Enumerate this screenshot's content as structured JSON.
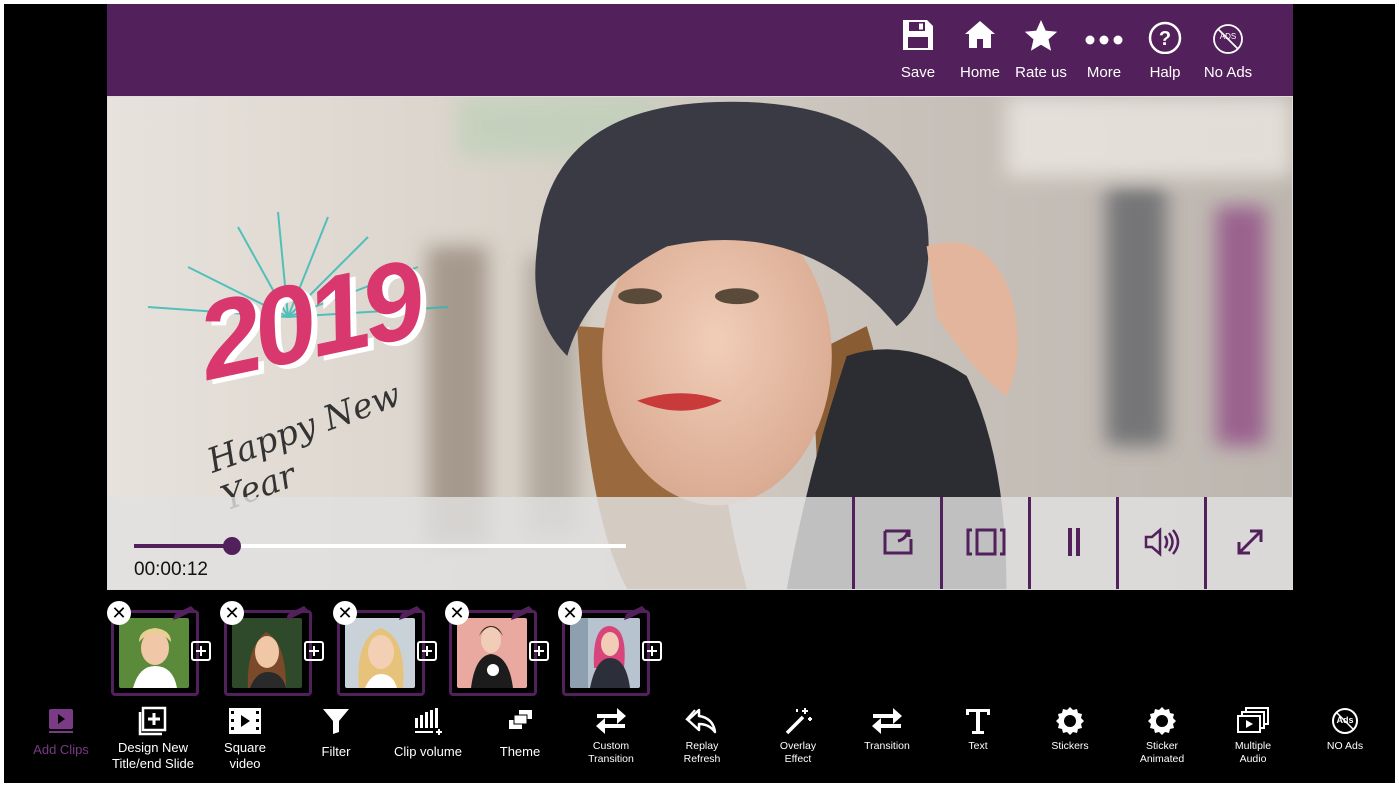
{
  "topbar": {
    "items": [
      {
        "label": "Save",
        "icon": "floppy-disk-icon"
      },
      {
        "label": "Home",
        "icon": "home-icon"
      },
      {
        "label": "Rate us",
        "icon": "star-icon"
      },
      {
        "label": "More",
        "icon": "dots-icon"
      },
      {
        "label": "Halp",
        "icon": "question-circle-icon"
      },
      {
        "label": "No Ads",
        "icon": "no-ads-icon"
      }
    ],
    "no_ads_badge": "ADS"
  },
  "preview": {
    "overlay_year": "2019",
    "overlay_text": "Happy New Year",
    "time": "00:00:12",
    "progress": 0.2
  },
  "clips": {
    "count": 5,
    "delete_glyph": "✕"
  },
  "toolbar": {
    "items": [
      {
        "label": "Add Clips",
        "icon": "video-clip-icon"
      },
      {
        "label": "Design New",
        "label2": "Title/end Slide",
        "icon": "add-slide-icon"
      },
      {
        "label": "Square",
        "label2": "video",
        "icon": "film-strip-icon"
      },
      {
        "label": "Filter",
        "icon": "funnel-icon"
      },
      {
        "label": "Clip volume",
        "icon": "volume-bars-icon"
      },
      {
        "label": "Theme",
        "icon": "theme-icon"
      },
      {
        "label": "Custom",
        "label2": "Transition",
        "icon": "swap-arrows-icon"
      },
      {
        "label": "Replay",
        "label2": "Refresh",
        "icon": "replay-icon"
      },
      {
        "label": "Overlay",
        "label2": "Effect",
        "icon": "magic-wand-icon"
      },
      {
        "label": "Transition",
        "icon": "swap-arrows-icon"
      },
      {
        "label": "Text",
        "icon": "text-icon"
      },
      {
        "label": "Stickers",
        "icon": "badge-icon"
      },
      {
        "label": "Sticker",
        "label2": "Animated",
        "icon": "badge-icon"
      },
      {
        "label": "Multiple",
        "label2": "Audio",
        "icon": "multi-audio-icon"
      },
      {
        "label": "NO Ads",
        "icon": "no-ads-icon"
      }
    ],
    "no_ads_badge": "Ads"
  },
  "colors": {
    "accent": "#52205a",
    "active_tool": "#7b3a86",
    "title_pink": "#d8386e"
  }
}
